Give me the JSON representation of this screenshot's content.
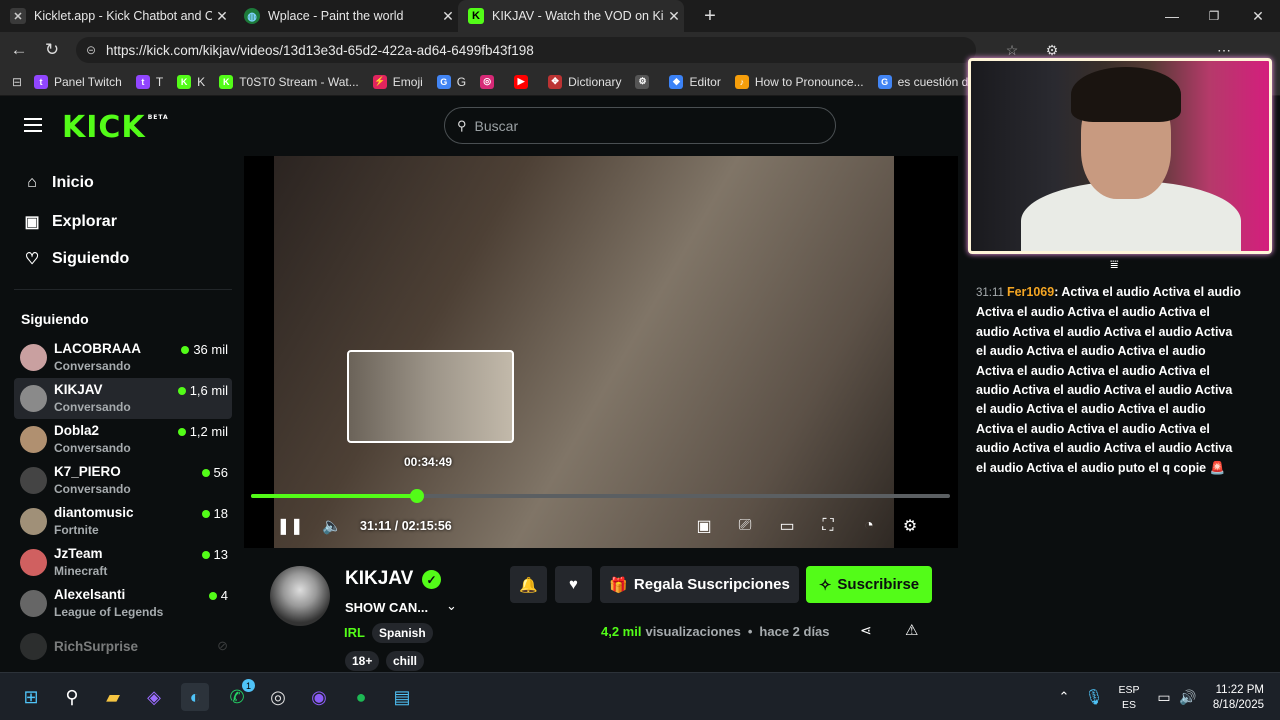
{
  "browser": {
    "tabs": [
      {
        "title": "Kicklet.app - Kick Chatbot and Ov",
        "favicon": "kicklet-icon"
      },
      {
        "title": "Wplace - Paint the world",
        "favicon": "globe-icon"
      },
      {
        "title": "KIKJAV - Watch the VOD on Kick",
        "favicon": "kick-icon",
        "active": true
      }
    ],
    "new_tab": "+",
    "url": "https://kick.com/kikjav/videos/13d13e3d-65d2-422a-ad64-6499fb43f198",
    "bookmarks": [
      {
        "label": "Panel Twitch",
        "color": "#9146ff",
        "glyph": "t"
      },
      {
        "label": "T",
        "color": "#9146ff",
        "glyph": "t"
      },
      {
        "label": "K",
        "color": "#53fc18",
        "glyph": "K"
      },
      {
        "label": "T0ST0 Stream - Wat...",
        "color": "#53fc18",
        "glyph": "K"
      },
      {
        "label": "Emoji",
        "color": "#e0245e",
        "glyph": "⚡"
      },
      {
        "label": "G",
        "color": "#4285f4",
        "glyph": "G"
      },
      {
        "label": "",
        "color": "#d62976",
        "glyph": "◎"
      },
      {
        "label": "",
        "color": "#ff0000",
        "glyph": "▶"
      },
      {
        "label": "Dictionary",
        "color": "#b33",
        "glyph": "✥"
      },
      {
        "label": "",
        "color": "#555",
        "glyph": "⚙"
      },
      {
        "label": "Editor",
        "color": "#3b82f6",
        "glyph": "◆"
      },
      {
        "label": "How to Pronounce...",
        "color": "#f59e0b",
        "glyph": "♪"
      },
      {
        "label": "es cuestión de t",
        "color": "#4285f4",
        "glyph": "G"
      }
    ]
  },
  "site": {
    "logo": "KICK",
    "logo_badge": "BETA",
    "search_placeholder": "Buscar"
  },
  "sidebar": {
    "nav": [
      {
        "label": "Inicio",
        "icon": "home-icon"
      },
      {
        "label": "Explorar",
        "icon": "compass-icon"
      },
      {
        "label": "Siguiendo",
        "icon": "heart-icon"
      }
    ],
    "following_title": "Siguiendo",
    "channels": [
      {
        "name": "LACOBRAAA",
        "sub": "Conversando",
        "viewers": "36 mil",
        "live": true,
        "avatar_color": "#c9a0a0"
      },
      {
        "name": "KIKJAV",
        "sub": "Conversando",
        "viewers": "1,6 mil",
        "live": true,
        "selected": true,
        "avatar_color": "#8a8a8a"
      },
      {
        "name": "Dobla2",
        "sub": "Conversando",
        "viewers": "1,2 mil",
        "live": true,
        "avatar_color": "#b09070"
      },
      {
        "name": "K7_PIERO",
        "sub": "Conversando",
        "viewers": "56",
        "live": true,
        "avatar_color": "#444"
      },
      {
        "name": "diantomusic",
        "sub": "Fortnite",
        "viewers": "18",
        "live": true,
        "avatar_color": "#a09078"
      },
      {
        "name": "JzTeam",
        "sub": "Minecraft",
        "viewers": "13",
        "live": true,
        "avatar_color": "#d06060"
      },
      {
        "name": "Alexelsanti",
        "sub": "League of Legends",
        "viewers": "4",
        "live": true,
        "avatar_color": "#666"
      },
      {
        "name": "RichSurprise",
        "sub": "",
        "viewers": "",
        "live": false,
        "avatar_color": "#555"
      }
    ]
  },
  "player": {
    "preview_time": "00:34:49",
    "time_display": "31:11 / 02:15:56",
    "progress": 0.237
  },
  "channel": {
    "name": "KIKJAV",
    "stream_title": "SHOW CAN...",
    "category": "IRL",
    "language": "Spanish",
    "tags": [
      "18+",
      "chill"
    ],
    "gift_label": "Regala Suscripciones",
    "subscribe_label": "Suscribirse",
    "views_count": "4,2 mil",
    "views_label": "visualizaciones",
    "separator": "•",
    "date": "hace 2 días"
  },
  "chat": {
    "timestamp": "31:11",
    "user": "Fer1069",
    "colon": ":",
    "message": "Activa el audio Activa el audio Activa el audio Activa el audio Activa el audio Activa el audio Activa el audio Activa el audio Activa el audio Activa el audio Activa el audio Activa el audio Activa el audio Activa el audio Activa el audio Activa el audio Activa el audio Activa el audio Activa el audio Activa el audio Activa el audio Activa el audio Activa el audio Activa el audio Activa el audio puto el q copie",
    "emoji": "🚨"
  },
  "taskbar": {
    "lang_top": "ESP",
    "lang_bottom": "ES",
    "time": "11:22 PM",
    "date": "8/18/2025",
    "whatsapp_badge": "1"
  }
}
